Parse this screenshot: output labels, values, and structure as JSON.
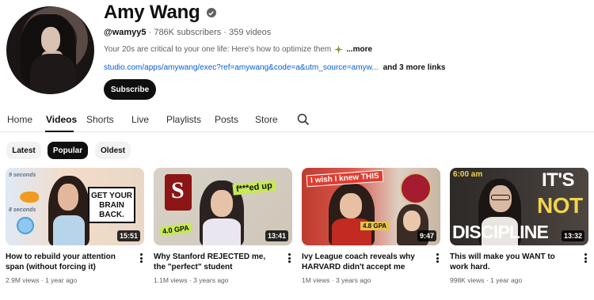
{
  "channel": {
    "name": "Amy Wang",
    "handle": "@wamyy5",
    "meta_rest": " · 786K subscribers · 359 videos",
    "description": "Your 20s are critical to your one life: Here's how to optimize them",
    "more_label": "...more",
    "link_url": "studio.com/apps/amywang/exec?ref=amywang&code=a&utm_source=amyw...",
    "more_links": "and 3 more links",
    "subscribe_label": "Subscribe"
  },
  "tabs": [
    "Home",
    "Videos",
    "Shorts",
    "Live",
    "Playlists",
    "Posts",
    "Store"
  ],
  "active_tab": "Videos",
  "chips": [
    "Latest",
    "Popular",
    "Oldest"
  ],
  "active_chip": "Popular",
  "videos": [
    {
      "title": "How to rebuild your attention span (without forcing it)",
      "views": "2.9M views",
      "age": "1 year ago",
      "duration": "15:51",
      "thumb_text": [
        "GET YOUR BRAIN BACK.",
        "9 seconds",
        "8 seconds"
      ]
    },
    {
      "title": "Why Stanford REJECTED me, the \"perfect\" student",
      "views": "1.1M views",
      "age": "3 years ago",
      "duration": "13:41",
      "thumb_text": [
        "f***ed up",
        "4.0 GPA",
        "S"
      ]
    },
    {
      "title": "Ivy League coach reveals why HARVARD didn't accept me",
      "views": "1M views",
      "age": "3 years ago",
      "duration": "9:47",
      "thumb_text": [
        "I wish I knew THIS",
        "4.8 GPA"
      ]
    },
    {
      "title": "This will make you WANT to work hard.",
      "views": "998K views",
      "age": "1 year ago",
      "duration": "13:32",
      "thumb_text": [
        "6:00 am",
        "IT'S",
        "NOT",
        "DISCIPLINE"
      ]
    }
  ],
  "colors": {
    "link": "#065fd4",
    "text": "#0f0f0f",
    "muted": "#606060",
    "chip_bg": "#f2f2f2"
  }
}
